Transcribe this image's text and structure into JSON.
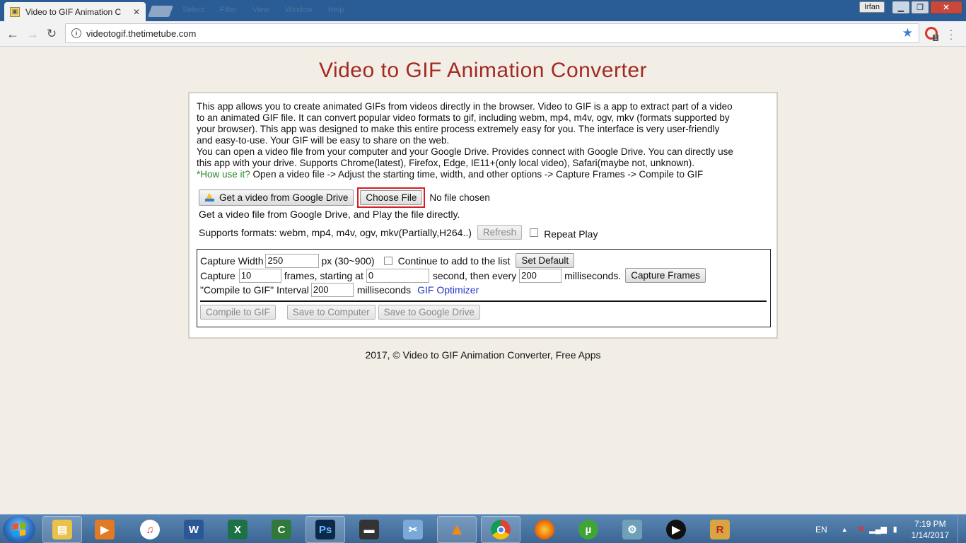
{
  "browser": {
    "tab_title": "Video to GIF Animation C",
    "tab_favicon": "app-favicon",
    "ghost_menu": [
      "Select",
      "Filter",
      "View",
      "Window",
      "Help"
    ],
    "profile_name": "Irfan",
    "url": "videotogif.thetimetube.com",
    "extension_badge": "1"
  },
  "page": {
    "title": "Video to GIF Animation Converter",
    "description_lines": [
      "This app allows you to create animated GIFs from videos directly in the browser. Video to GIF is a app to extract part of a video",
      "to an animated GIF file. It can convert popular video formats to gif, including webm, mp4, m4v, ogv, mkv (formats supported by",
      "your browser). This app was designed to make this entire process extremely easy for you. The interface is very user-friendly",
      "and easy-to-use. Your GIF will be easy to share on the web.",
      "You can open a video file from your computer and your Google Drive. Provides connect with Google Drive. You can directly use",
      "this app with your drive. Supports Chrome(latest), Firefox, Edge, IE11+(only local video), Safari(maybe not, unknown)."
    ],
    "howto_label": "*How use it?",
    "howto_text": " Open a video file -> Adjust the starting time, width, and other options -> Capture Frames -> Compile to GIF",
    "gdrive_button": "Get a video from Google Drive",
    "choose_file_button": "Choose File",
    "file_status": "No file chosen",
    "gdrive_note": "Get a video file from Google Drive, and Play the file directly.",
    "formats_text": "Supports formats: webm, mp4, m4v, ogv, mkv(Partially,H264..)",
    "refresh_button": "Refresh",
    "repeat_play_label": "Repeat Play",
    "options": {
      "capture_width_label": "Capture Width",
      "capture_width_value": "250",
      "width_unit": "px (30~900)",
      "continue_label": "Continue to add to the list",
      "set_default_button": "Set Default",
      "capture_label": "Capture",
      "frames_value": "10",
      "frames_starting_label": "frames, starting at",
      "start_value": "0",
      "second_every_label": "second, then every",
      "every_value": "200",
      "milliseconds_label": "milliseconds.",
      "capture_frames_button": "Capture Frames",
      "compile_interval_label": "\"Compile to GIF\" Interval",
      "interval_value": "200",
      "interval_unit": "milliseconds",
      "gif_optimizer_link": "GIF Optimizer",
      "compile_button": "Compile to GIF",
      "save_computer_button": "Save to Computer",
      "save_drive_button": "Save to Google Drive"
    },
    "footer": "2017, © Video to GIF Animation Converter, Free Apps"
  },
  "taskbar": {
    "apps": [
      "file-explorer",
      "media-player",
      "itunes",
      "word",
      "excel",
      "camtasia",
      "photoshop",
      "projector",
      "snipping-tool",
      "vlc",
      "chrome",
      "firefox",
      "utorrent",
      "settings-gears",
      "media-play",
      "r-app"
    ],
    "language": "EN",
    "time": "7:19 PM",
    "date": "1/14/2017"
  },
  "colors": {
    "title_red": "#a32a21",
    "howto_green": "#2a8a2a",
    "link_blue": "#2234c8",
    "highlight_red": "#d42020",
    "taskbar_blue": "#3b6694"
  }
}
